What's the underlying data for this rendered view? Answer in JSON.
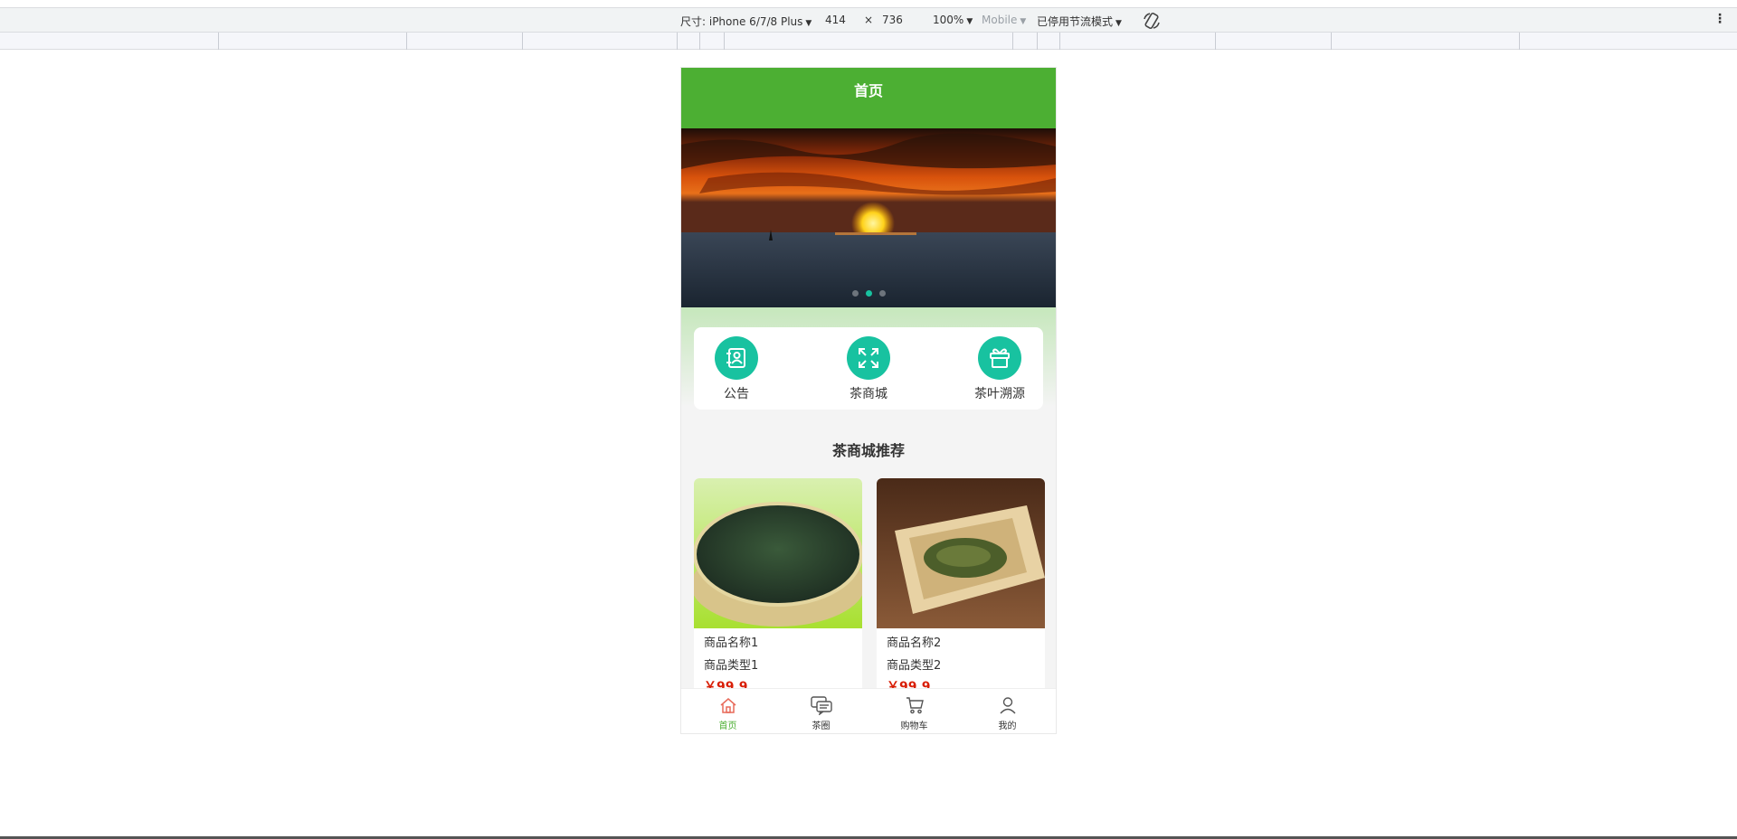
{
  "devtools": {
    "dimensions_label": "尺寸: iPhone 6/7/8 Plus",
    "width": "414",
    "times": "×",
    "height": "736",
    "zoom": "100%",
    "device_type": "Mobile",
    "throttling": "已停用节流模式"
  },
  "app": {
    "header_title": "首页",
    "banner": {
      "slide_count": 3,
      "active_index": 1
    },
    "menu": [
      {
        "label": "公告",
        "icon": "notice-book-icon"
      },
      {
        "label": "茶商城",
        "icon": "expand-arrows-icon"
      },
      {
        "label": "茶叶溯源",
        "icon": "gift-box-icon"
      }
    ],
    "section_title": "茶商城推荐",
    "products": [
      {
        "name": "商品名称1",
        "type": "商品类型1",
        "price": "￥99.9"
      },
      {
        "name": "商品名称2",
        "type": "商品类型2",
        "price": "￥99.9"
      }
    ],
    "tabbar": [
      {
        "label": "首页",
        "icon": "home-icon",
        "active": true
      },
      {
        "label": "茶圈",
        "icon": "chat-bubbles-icon",
        "active": false
      },
      {
        "label": "购物车",
        "icon": "cart-icon",
        "active": false
      },
      {
        "label": "我的",
        "icon": "user-icon",
        "active": false
      }
    ]
  },
  "colors": {
    "primary_green": "#4caf33",
    "accent_teal": "#18c2a0",
    "price_red": "#d81e06"
  }
}
